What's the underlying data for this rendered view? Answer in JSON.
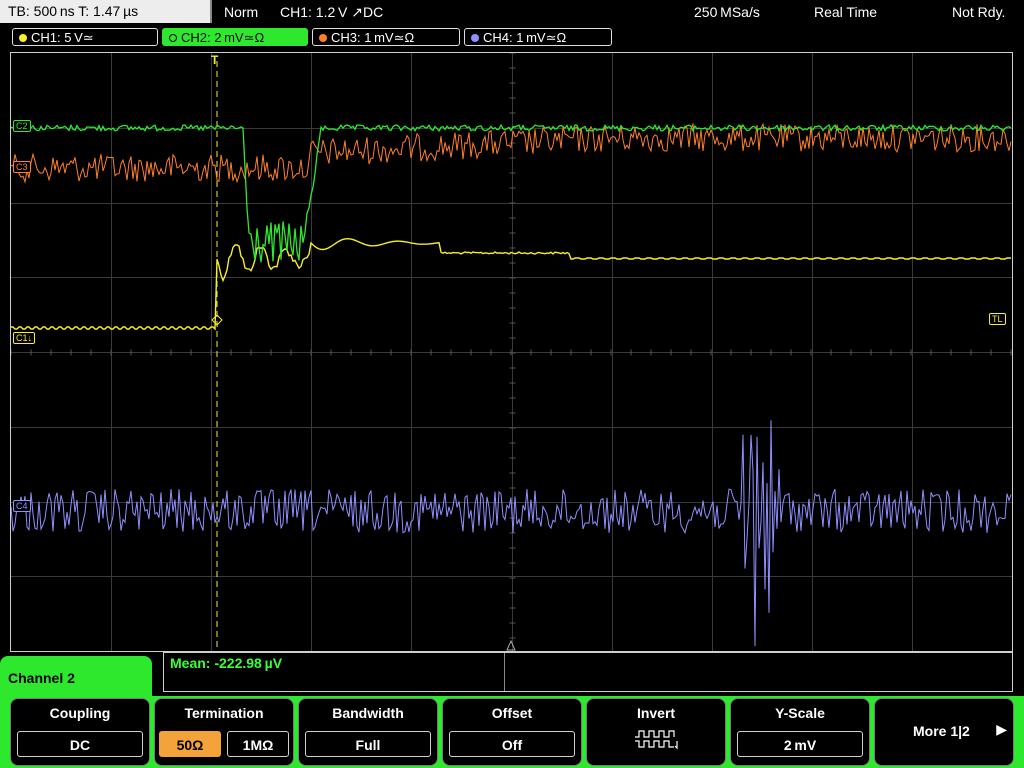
{
  "top": {
    "timebase": "TB: 500 ns   T: 1.47 µs",
    "trigger_mode": "Norm",
    "trigger": "CH1: 1.2 V ↗DC",
    "sample_rate": "250 MSa/s",
    "acq_mode": "Real Time",
    "status": "Not Rdy."
  },
  "channels": [
    {
      "label": "CH1: 5 V≃",
      "color": "#f5ee2a"
    },
    {
      "label": "CH2: 2 mV≃Ω",
      "color": "#2ee82e"
    },
    {
      "label": "CH3: 1 mV≃Ω",
      "color": "#ff7f2a"
    },
    {
      "label": "CH4: 1 mV≃Ω",
      "color": "#8f8fff"
    }
  ],
  "markers": {
    "c2": "C2",
    "c3": "C3",
    "c1": "C1↓",
    "c4": "C4",
    "tl": "TL",
    "trigger": "T"
  },
  "measurement": "Mean: -222.98 µV",
  "panel": {
    "title": "Channel 2",
    "coupling": {
      "title": "Coupling",
      "value": "DC"
    },
    "termination": {
      "title": "Termination",
      "options": [
        "50Ω",
        "1MΩ"
      ],
      "selected": "50Ω"
    },
    "bandwidth": {
      "title": "Bandwidth",
      "value": "Full"
    },
    "offset": {
      "title": "Offset",
      "value": "Off"
    },
    "invert": {
      "title": "Invert",
      "icon": "invert-waveform-icon"
    },
    "yscale": {
      "title": "Y-Scale",
      "value": "2 mV"
    },
    "more": {
      "label": "More 1|2"
    }
  }
}
